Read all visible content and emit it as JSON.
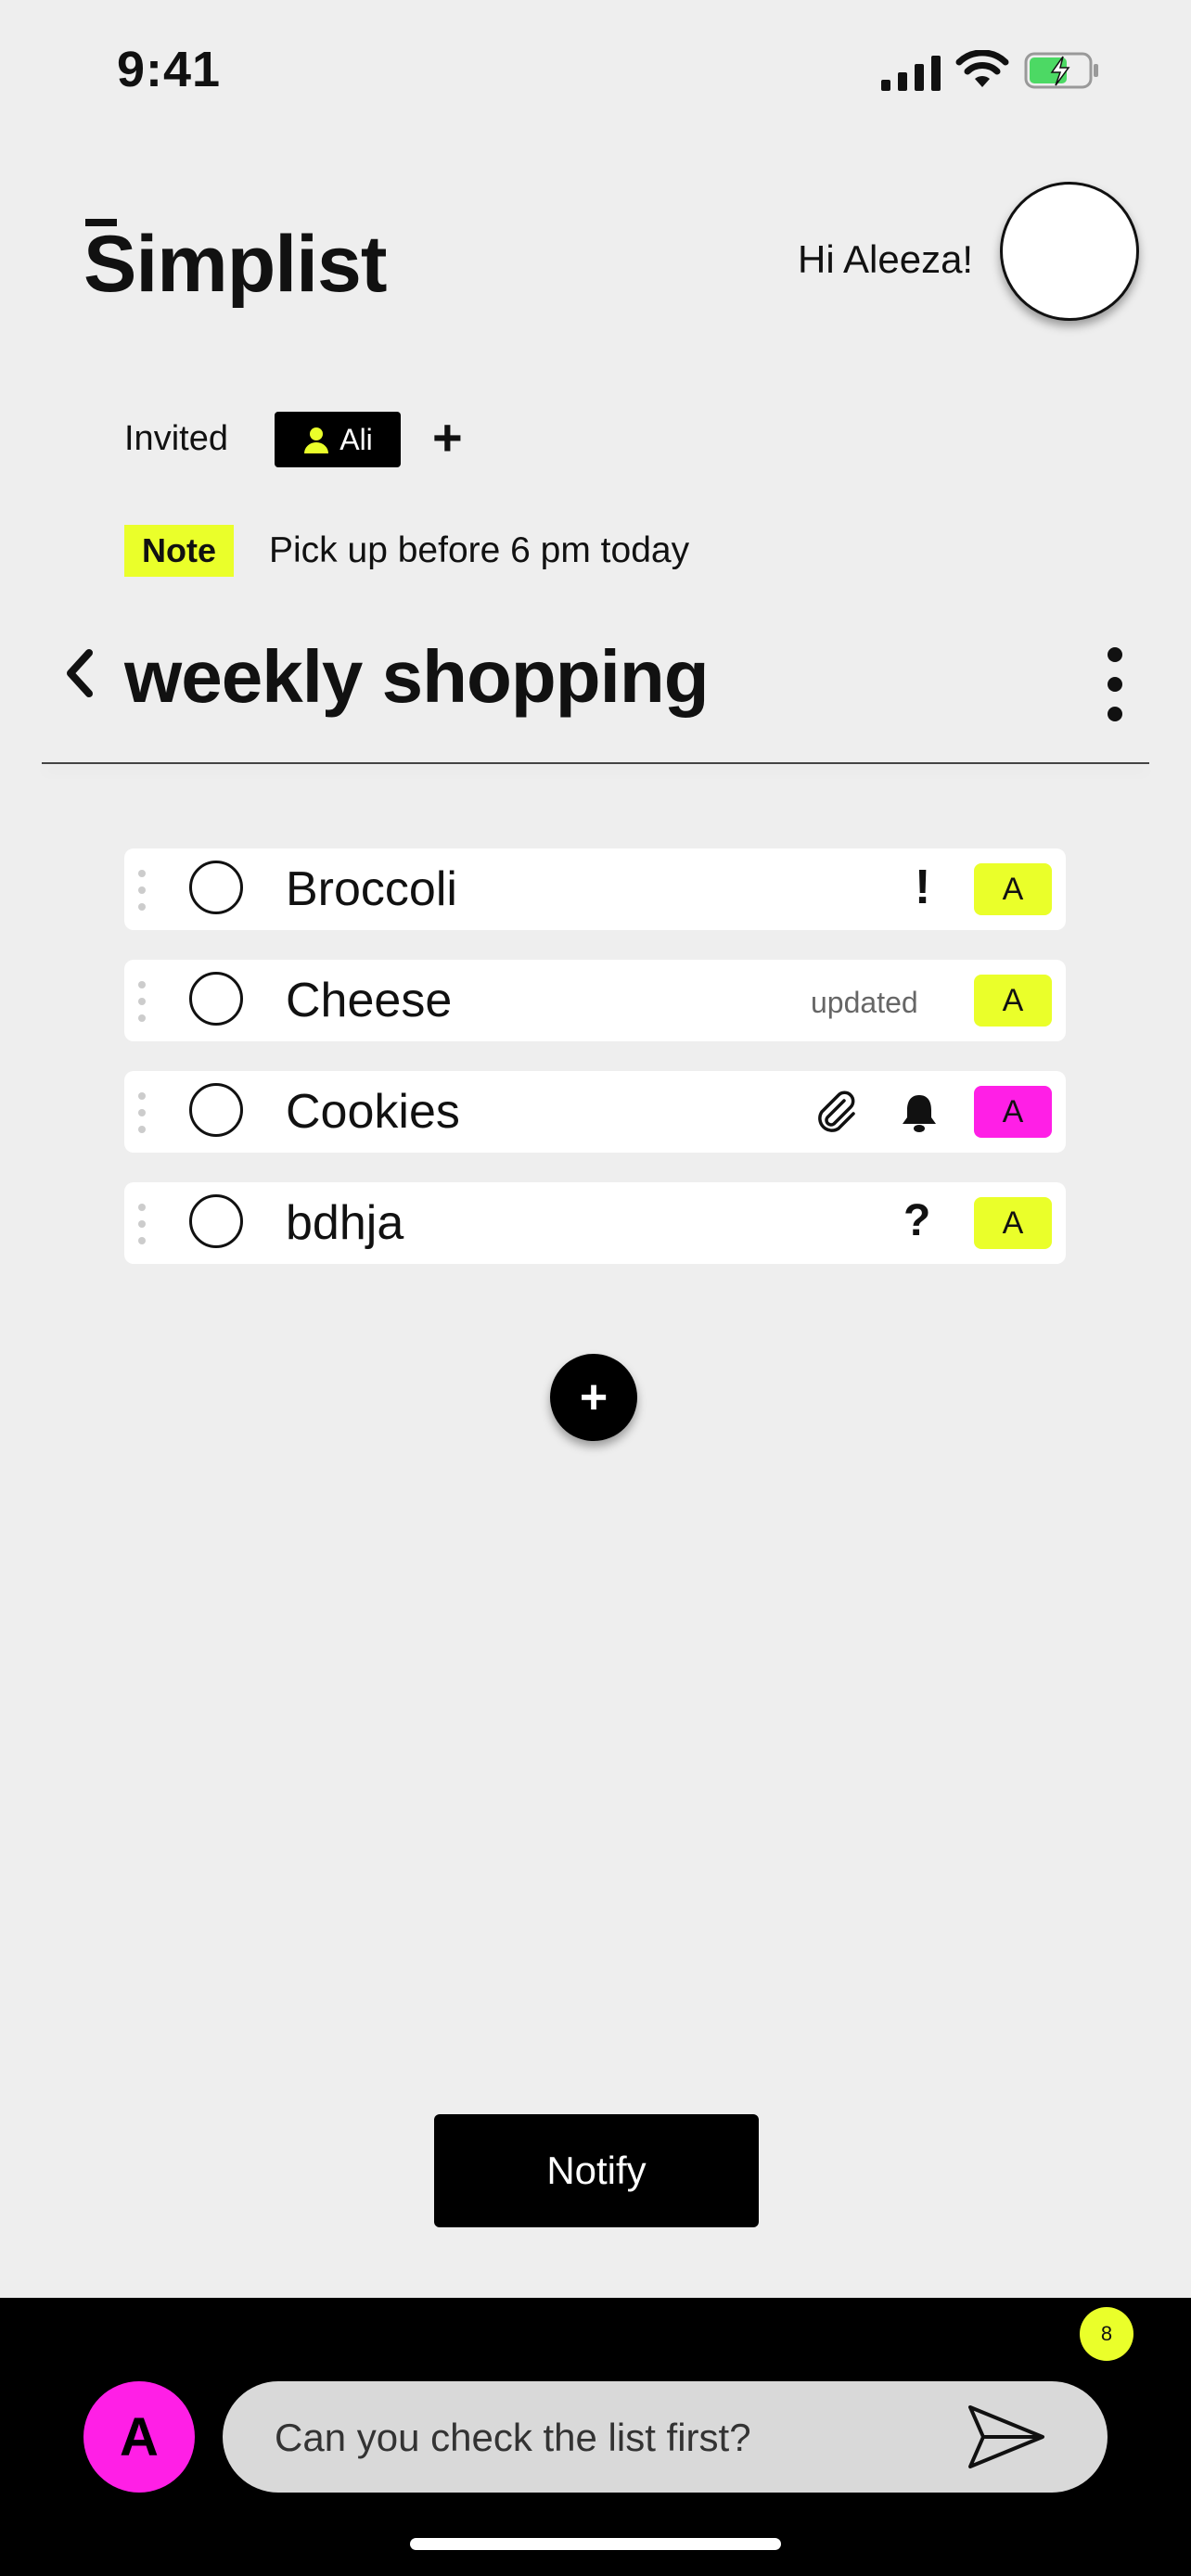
{
  "status_bar": {
    "time": "9:41"
  },
  "header": {
    "logo": "Simplist",
    "greeting": "Hi Aleeza!"
  },
  "invited": {
    "label": "Invited",
    "people": [
      {
        "name": "Ali"
      }
    ],
    "add_symbol": "+"
  },
  "note": {
    "tag": "Note",
    "text": "Pick up before 6 pm today"
  },
  "list": {
    "title": "weekly shopping",
    "items": [
      {
        "name": "Broccoli",
        "indicator": "!",
        "assignee": "A",
        "assignee_color": "#eaff2a"
      },
      {
        "name": "Cheese",
        "indicator": "updated",
        "assignee": "A",
        "assignee_color": "#eaff2a"
      },
      {
        "name": "Cookies",
        "icons": [
          "paperclip-icon",
          "bell-icon"
        ],
        "assignee": "A",
        "assignee_color": "#ff1fe6"
      },
      {
        "name": "bdhja",
        "indicator": "?",
        "assignee": "A",
        "assignee_color": "#eaff2a"
      }
    ]
  },
  "add_item_symbol": "+",
  "notify_button": "Notify",
  "chat": {
    "unread_count": "8",
    "user_initial": "A",
    "placeholder": "Can you check the list first?"
  },
  "colors": {
    "accent_yellow": "#eaff2a",
    "accent_magenta": "#ff1fe6",
    "background": "#eeeeee"
  }
}
